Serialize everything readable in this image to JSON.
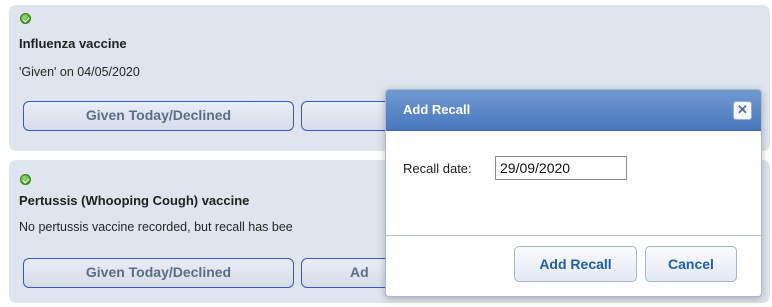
{
  "vaccines": [
    {
      "title": "Influenza vaccine",
      "status": "'Given' on 04/05/2020",
      "buttons": {
        "given_declined": "Given Today/Declined",
        "second": ""
      }
    },
    {
      "title": "Pertussis (Whooping Cough) vaccine",
      "status": "No pertussis vaccine recorded, but recall has bee",
      "buttons": {
        "given_declined": "Given Today/Declined",
        "second": "Ad"
      }
    }
  ],
  "dialog": {
    "title": "Add Recall",
    "close_icon": "close-icon",
    "field_label": "Recall date:",
    "recall_date": "29/09/2020",
    "add_button": "Add Recall",
    "cancel_button": "Cancel"
  },
  "colors": {
    "card_background": "#dfe5ee",
    "button_border": "#3b56c9",
    "dialog_titlebar": "#5a86c7",
    "status_ok": "#4fa629"
  }
}
